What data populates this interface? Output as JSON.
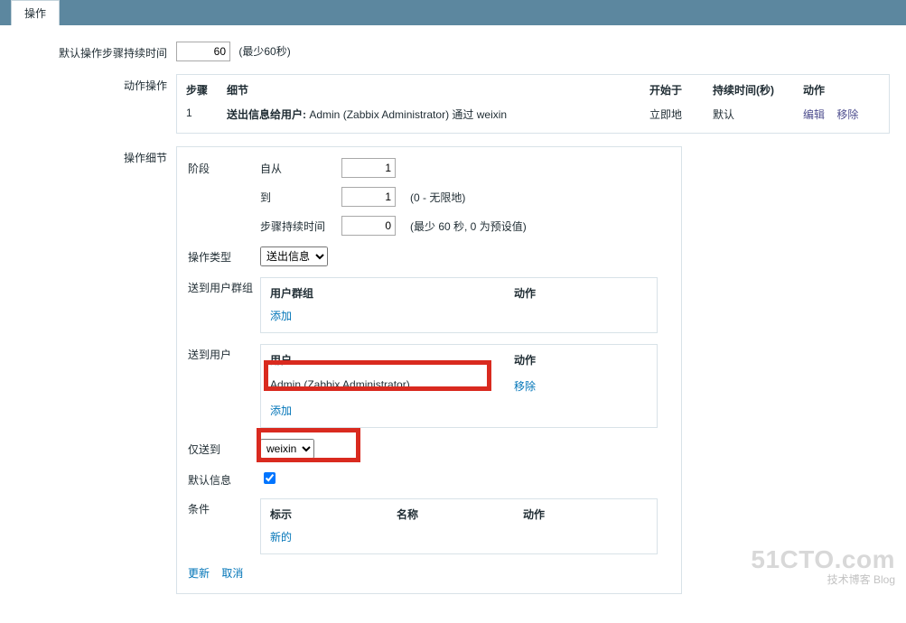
{
  "tab": {
    "label": "操作"
  },
  "default_step_duration": {
    "label": "默认操作步骤持续时间",
    "value": "60",
    "hint": "(最少60秒)"
  },
  "actions": {
    "label": "动作操作",
    "headers": {
      "step": "步骤",
      "detail": "细节",
      "start": "开始于",
      "duration": "持续时间(秒)",
      "action": "动作"
    },
    "rows": [
      {
        "step": "1",
        "detail_prefix": "送出信息给用户: ",
        "detail_body": "Admin (Zabbix Administrator) 通过 weixin",
        "start": "立即地",
        "duration": "默认",
        "edit": "编辑",
        "remove": "移除"
      }
    ]
  },
  "op_detail": {
    "label": "操作细节",
    "stage": {
      "label": "阶段",
      "from_label": "自从",
      "from_value": "1",
      "to_label": "到",
      "to_value": "1",
      "to_hint": "(0 - 无限地)",
      "dur_label": "步骤持续时间",
      "dur_value": "0",
      "dur_hint": "(最少 60 秒, 0 为预设值)"
    },
    "op_type": {
      "label": "操作类型",
      "value": "送出信息"
    },
    "user_group": {
      "label": "送到用户群组",
      "col1": "用户群组",
      "col2": "动作",
      "add": "添加"
    },
    "user": {
      "label": "送到用户",
      "col1": "用户",
      "col2": "动作",
      "row_name": "Admin (Zabbix Administrator)",
      "row_action": "移除",
      "add": "添加"
    },
    "only_to": {
      "label": "仅送到",
      "value": "weixin"
    },
    "default_msg": {
      "label": "默认信息",
      "checked": true
    },
    "cond": {
      "label": "条件",
      "col_tag": "标示",
      "col_name": "名称",
      "col_action": "动作",
      "new": "新的"
    },
    "update": "更新",
    "cancel": "取消"
  },
  "watermark": {
    "big": "51CTO.com",
    "small": "技术博客   Blog"
  }
}
